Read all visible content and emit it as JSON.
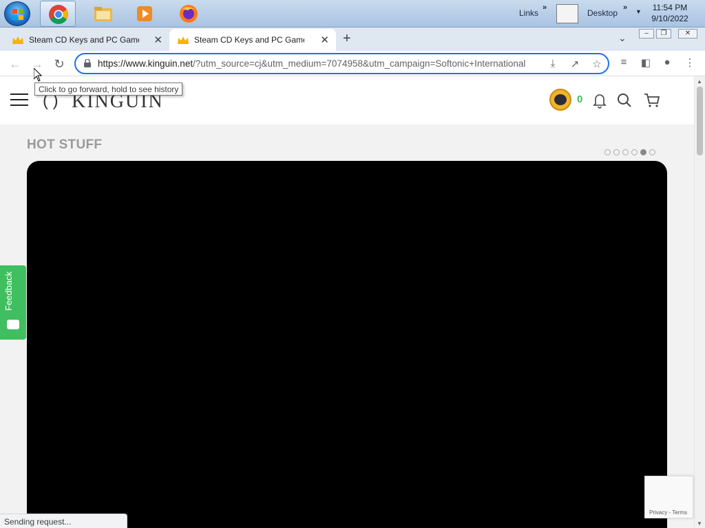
{
  "taskbar": {
    "links_label": "Links",
    "desktop_label": "Desktop",
    "chevron": "»",
    "clock_time": "11:54 PM",
    "clock_date": "9/10/2022",
    "apps": [
      "chrome-icon",
      "file-explorer-icon",
      "media-player-icon",
      "firefox-icon"
    ]
  },
  "browser": {
    "tabs": [
      {
        "title": "Steam CD Keys and PC Game Keys",
        "active": false
      },
      {
        "title": "Steam CD Keys and PC Game Keys",
        "active": true
      }
    ],
    "new_tab": "+",
    "tab_close": "✕",
    "url_host": "https://www.kinguin.net",
    "url_path": "/?utm_source=cj&utm_medium=7074958&utm_campaign=Softonic+International",
    "tooltip": "Click to go forward, hold to see history",
    "status": "Sending request..."
  },
  "site": {
    "logo_text": "KINGUIN",
    "coin_count": "0",
    "section_title": "HOT STUFF",
    "carousel_dots": 6,
    "carousel_active_index": 4,
    "feedback_label": "Feedback",
    "recaptcha_links": "Privacy - Terms",
    "accent_color": "#3fbf5f"
  }
}
